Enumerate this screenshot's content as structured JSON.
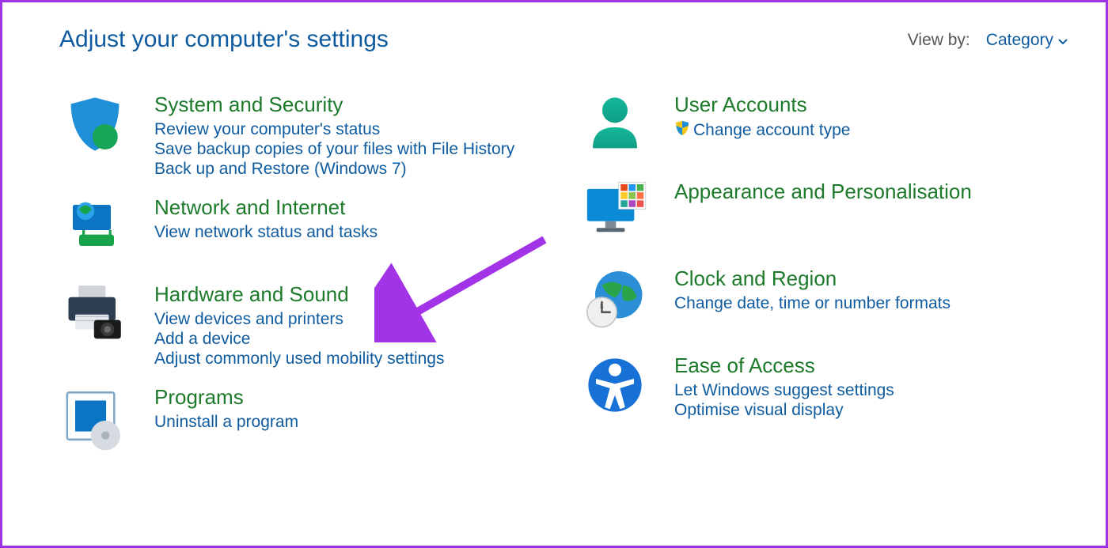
{
  "header": {
    "title": "Adjust your computer's settings",
    "view_by_label": "View by:",
    "view_by_value": "Category"
  },
  "left": {
    "system_security": {
      "title": "System and Security",
      "link1": "Review your computer's status",
      "link2": "Save backup copies of your files with File History",
      "link3": "Back up and Restore (Windows 7)"
    },
    "network": {
      "title": "Network and Internet",
      "link1": "View network status and tasks"
    },
    "hardware": {
      "title": "Hardware and Sound",
      "link1": "View devices and printers",
      "link2": "Add a device",
      "link3": "Adjust commonly used mobility settings"
    },
    "programs": {
      "title": "Programs",
      "link1": "Uninstall a program"
    }
  },
  "right": {
    "user_accounts": {
      "title": "User Accounts",
      "link1": "Change account type"
    },
    "appearance": {
      "title": "Appearance and Personalisation"
    },
    "clock": {
      "title": "Clock and Region",
      "link1": "Change date, time or number formats"
    },
    "ease": {
      "title": "Ease of Access",
      "link1": "Let Windows suggest settings",
      "link2": "Optimise visual display"
    }
  }
}
